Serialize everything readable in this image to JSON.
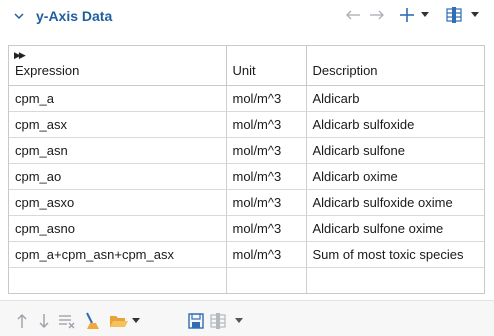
{
  "section": {
    "title": "y-Axis Data",
    "collapse_icon": "chevron-down-icon"
  },
  "header_tools": [
    {
      "name": "arrow-left-icon"
    },
    {
      "name": "arrow-right-icon"
    },
    {
      "name": "add-plus-icon"
    },
    {
      "name": "dropdown-caret-icon"
    },
    {
      "name": "table-layout-icon"
    }
  ],
  "table": {
    "columns": [
      "Expression",
      "Unit",
      "Description"
    ],
    "rows": [
      {
        "expression": "cpm_a",
        "unit": "mol/m^3",
        "description": "Aldicarb"
      },
      {
        "expression": "cpm_asx",
        "unit": "mol/m^3",
        "description": "Aldicarb sulfoxide"
      },
      {
        "expression": "cpm_asn",
        "unit": "mol/m^3",
        "description": "Aldicarb sulfone"
      },
      {
        "expression": "cpm_ao",
        "unit": "mol/m^3",
        "description": "Aldicarb oxime"
      },
      {
        "expression": "cpm_asxo",
        "unit": "mol/m^3",
        "description": "Aldicarb sulfoxide oxime"
      },
      {
        "expression": "cpm_asno",
        "unit": "mol/m^3",
        "description": "Aldicarb sulfone oxime"
      },
      {
        "expression": "cpm_a+cpm_asn+cpm_asx",
        "unit": "mol/m^3",
        "description": "Sum of most toxic species"
      },
      {
        "expression": "",
        "unit": "",
        "description": ""
      }
    ]
  },
  "bottom_tools": [
    {
      "name": "move-up-icon"
    },
    {
      "name": "move-down-icon"
    },
    {
      "name": "clear-table-icon"
    },
    {
      "name": "brush-icon"
    },
    {
      "name": "open-folder-icon"
    },
    {
      "name": "save-icon"
    },
    {
      "name": "table-layout-icon"
    }
  ],
  "colors": {
    "title": "#1f5f9e",
    "icon_blue": "#2f6db5",
    "icon_gray": "#9aa0a8",
    "folder": "#e8a23a",
    "brush": "#f2a93b"
  }
}
